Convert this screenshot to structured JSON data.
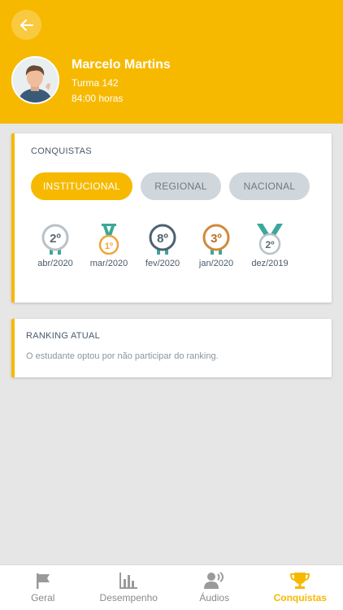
{
  "profile": {
    "name": "Marcelo Martins",
    "turma": "Turma 142",
    "hours": "84:00 horas"
  },
  "conquistas": {
    "title": "CONQUISTAS",
    "tabs": [
      {
        "label": "INSTITUCIONAL",
        "active": true
      },
      {
        "label": "REGIONAL",
        "active": false
      },
      {
        "label": "NACIONAL",
        "active": false
      }
    ],
    "medals": [
      {
        "place": "2º",
        "date": "abr/2020",
        "style": "silver-plain"
      },
      {
        "place": "1º",
        "date": "mar/2020",
        "style": "gold-ribbon"
      },
      {
        "place": "8º",
        "date": "fev/2020",
        "style": "dark-plain"
      },
      {
        "place": "3º",
        "date": "jan/2020",
        "style": "bronze-plain"
      },
      {
        "place": "2º",
        "date": "dez/2019",
        "style": "silver-ribbon"
      }
    ]
  },
  "ranking": {
    "title": "RANKING ATUAL",
    "message": "O estudante optou por não participar do ranking."
  },
  "nav": [
    {
      "label": "Geral",
      "icon": "flag-icon",
      "active": false
    },
    {
      "label": "Desempenho",
      "icon": "bar-chart-icon",
      "active": false
    },
    {
      "label": "Áudios",
      "icon": "speaker-person-icon",
      "active": false
    },
    {
      "label": "Conquistas",
      "icon": "trophy-icon",
      "active": true
    }
  ],
  "colors": {
    "accent": "#f7b900",
    "teal": "#3aa89a",
    "gray": "#cfd7dc"
  }
}
